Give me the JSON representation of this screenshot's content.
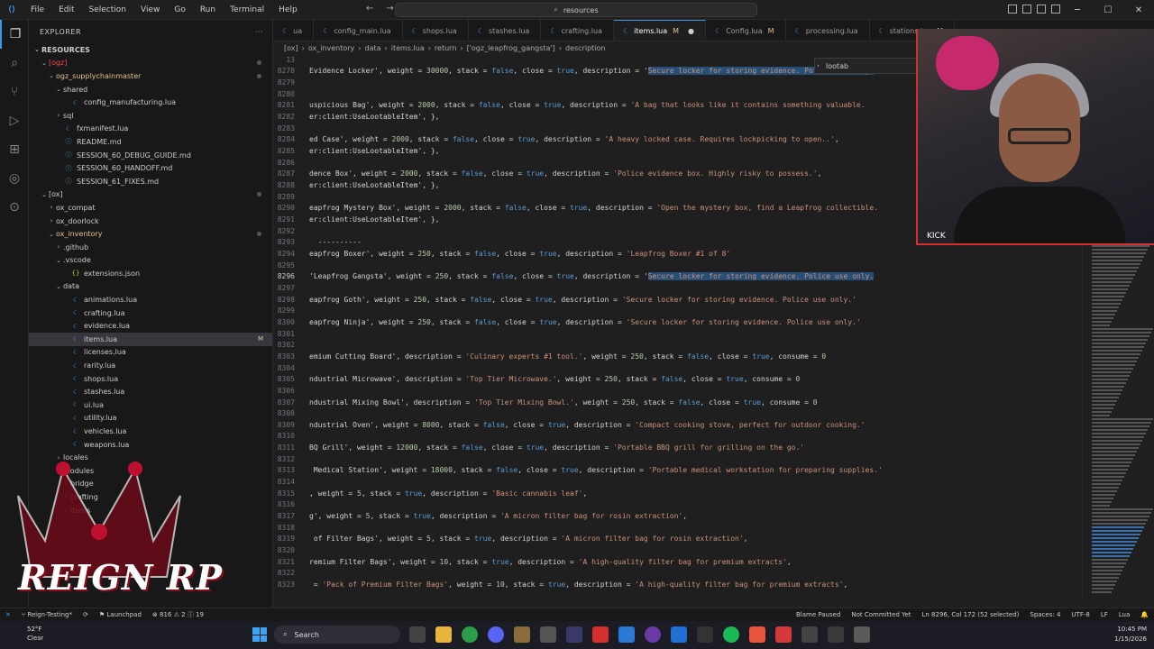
{
  "menu": [
    "File",
    "Edit",
    "Selection",
    "View",
    "Go",
    "Run",
    "Terminal",
    "Help"
  ],
  "search": {
    "text": "resources"
  },
  "sidebar": {
    "title": "EXPLORER",
    "root": "RESOURCES",
    "items": [
      {
        "label": "[ogz]",
        "indent": 1,
        "type": "folder",
        "open": true,
        "color": "red"
      },
      {
        "label": "ogz_supplychainmaster",
        "indent": 2,
        "type": "folder",
        "open": true,
        "color": "gold"
      },
      {
        "label": "shared",
        "indent": 3,
        "type": "folder",
        "open": true
      },
      {
        "label": "config_manufacturing.lua",
        "indent": 4,
        "type": "lua"
      },
      {
        "label": "sql",
        "indent": 3,
        "type": "folder",
        "open": false
      },
      {
        "label": "fxmanifest.lua",
        "indent": 3,
        "type": "lua"
      },
      {
        "label": "README.md",
        "indent": 3,
        "type": "md"
      },
      {
        "label": "SESSION_60_DEBUG_GUIDE.md",
        "indent": 3,
        "type": "md"
      },
      {
        "label": "SESSION_60_HANDOFF.md",
        "indent": 3,
        "type": "md"
      },
      {
        "label": "SESSION_61_FIXES.md",
        "indent": 3,
        "type": "md"
      },
      {
        "label": "[ox]",
        "indent": 1,
        "type": "folder",
        "open": true
      },
      {
        "label": "ox_compat",
        "indent": 2,
        "type": "folder",
        "open": false
      },
      {
        "label": "ox_doorlock",
        "indent": 2,
        "type": "folder",
        "open": false
      },
      {
        "label": "ox_inventory",
        "indent": 2,
        "type": "folder",
        "open": true,
        "color": "gold"
      },
      {
        "label": ".github",
        "indent": 3,
        "type": "folder",
        "open": false
      },
      {
        "label": ".vscode",
        "indent": 3,
        "type": "folder",
        "open": true
      },
      {
        "label": "extensions.json",
        "indent": 4,
        "type": "json"
      },
      {
        "label": "data",
        "indent": 3,
        "type": "folder",
        "open": true
      },
      {
        "label": "animations.lua",
        "indent": 4,
        "type": "lua"
      },
      {
        "label": "crafting.lua",
        "indent": 4,
        "type": "lua"
      },
      {
        "label": "evidence.lua",
        "indent": 4,
        "type": "lua"
      },
      {
        "label": "items.lua",
        "indent": 4,
        "type": "lua",
        "selected": true,
        "badge": "M"
      },
      {
        "label": "licenses.lua",
        "indent": 4,
        "type": "lua"
      },
      {
        "label": "rarity.lua",
        "indent": 4,
        "type": "lua"
      },
      {
        "label": "shops.lua",
        "indent": 4,
        "type": "lua"
      },
      {
        "label": "stashes.lua",
        "indent": 4,
        "type": "lua"
      },
      {
        "label": "ui.lua",
        "indent": 4,
        "type": "lua"
      },
      {
        "label": "utility.lua",
        "indent": 4,
        "type": "lua"
      },
      {
        "label": "vehicles.lua",
        "indent": 4,
        "type": "lua"
      },
      {
        "label": "weapons.lua",
        "indent": 4,
        "type": "lua"
      },
      {
        "label": "locales",
        "indent": 3,
        "type": "folder",
        "open": false
      },
      {
        "label": "modules",
        "indent": 3,
        "type": "folder",
        "open": true
      },
      {
        "label": "bridge",
        "indent": 4,
        "type": "folder",
        "open": false
      },
      {
        "label": "crafting",
        "indent": 4,
        "type": "folder",
        "open": false
      },
      {
        "label": "items",
        "indent": 4,
        "type": "folder",
        "open": false
      }
    ]
  },
  "tabs": [
    {
      "label": "ua",
      "mod": ""
    },
    {
      "label": "config_main.lua",
      "mod": ""
    },
    {
      "label": "shops.lua",
      "mod": ""
    },
    {
      "label": "stashes.lua",
      "mod": ""
    },
    {
      "label": "crafting.lua",
      "mod": ""
    },
    {
      "label": "items.lua",
      "mod": "M",
      "active": true
    },
    {
      "label": "Config.lua",
      "mod": "M"
    },
    {
      "label": "processing.lua",
      "mod": ""
    },
    {
      "label": "stations.lua",
      "mod": "M"
    }
  ],
  "breadcrumb": [
    "[ox]",
    "ox_inventory",
    "data",
    "items.lua",
    "return",
    "['ogz_leapfrog_gangsta']",
    "description"
  ],
  "find_widget": {
    "text": "lootab"
  },
  "code": [
    {
      "ln": "13",
      "segs": []
    },
    {
      "ln": "8278",
      "segs": [
        [
          "t",
          "Evidence Locker', weight = "
        ],
        [
          "n",
          "30000"
        ],
        [
          "t",
          ", stack = "
        ],
        [
          "k",
          "false"
        ],
        [
          "t",
          ", close = "
        ],
        [
          "k",
          "true"
        ],
        [
          "t",
          ", description = '"
        ],
        [
          "h",
          "Secure locker for storing evidence. Police use only."
        ]
      ]
    },
    {
      "ln": "8279",
      "segs": []
    },
    {
      "ln": "8280",
      "segs": []
    },
    {
      "ln": "8281",
      "segs": [
        [
          "t",
          "uspicious Bag', weight = "
        ],
        [
          "n",
          "2000"
        ],
        [
          "t",
          ", stack = "
        ],
        [
          "k",
          "false"
        ],
        [
          "t",
          ", close = "
        ],
        [
          "k",
          "true"
        ],
        [
          "t",
          ", description = "
        ],
        [
          "s",
          "'A bag that looks like it contains something valuable."
        ]
      ]
    },
    {
      "ln": "8282",
      "segs": [
        [
          "t",
          "er:client:UseLootableItem', },"
        ]
      ]
    },
    {
      "ln": "8283",
      "segs": []
    },
    {
      "ln": "8284",
      "segs": [
        [
          "t",
          "ed Case', weight = "
        ],
        [
          "n",
          "2000"
        ],
        [
          "t",
          ", stack = "
        ],
        [
          "k",
          "false"
        ],
        [
          "t",
          ", close = "
        ],
        [
          "k",
          "true"
        ],
        [
          "t",
          ", description = "
        ],
        [
          "s",
          "'A heavy locked case. Requires lockpicking to open..'"
        ],
        [
          "t",
          ","
        ]
      ]
    },
    {
      "ln": "8285",
      "segs": [
        [
          "t",
          "er:client:UseLootableItem', },"
        ]
      ]
    },
    {
      "ln": "8286",
      "segs": []
    },
    {
      "ln": "8287",
      "segs": [
        [
          "t",
          "dence Box', weight = "
        ],
        [
          "n",
          "2000"
        ],
        [
          "t",
          ", stack = "
        ],
        [
          "k",
          "false"
        ],
        [
          "t",
          ", close = "
        ],
        [
          "k",
          "true"
        ],
        [
          "t",
          ", description = "
        ],
        [
          "s",
          "'Police evidence box. Highly risky to possess.'"
        ],
        [
          "t",
          ","
        ]
      ]
    },
    {
      "ln": "8288",
      "segs": [
        [
          "t",
          "er:client:UseLootableItem', },"
        ]
      ]
    },
    {
      "ln": "8289",
      "segs": []
    },
    {
      "ln": "8290",
      "segs": [
        [
          "t",
          "eapfrog Mystery Box', weight = "
        ],
        [
          "n",
          "2000"
        ],
        [
          "t",
          ", stack = "
        ],
        [
          "k",
          "false"
        ],
        [
          "t",
          ", close = "
        ],
        [
          "k",
          "true"
        ],
        [
          "t",
          ", description = "
        ],
        [
          "s",
          "'Open the mystery box, find a Leapfrog collectible."
        ]
      ]
    },
    {
      "ln": "8291",
      "segs": [
        [
          "t",
          "er:client:UseLootableItem', },"
        ]
      ]
    },
    {
      "ln": "8292",
      "segs": []
    },
    {
      "ln": "8293",
      "segs": [
        [
          "t",
          "  ----------"
        ]
      ]
    },
    {
      "ln": "8294",
      "segs": [
        [
          "t",
          "eapfrog Boxer', weight = "
        ],
        [
          "n",
          "250"
        ],
        [
          "t",
          ", stack = "
        ],
        [
          "k",
          "false"
        ],
        [
          "t",
          ", close = "
        ],
        [
          "k",
          "true"
        ],
        [
          "t",
          ", description = "
        ],
        [
          "s",
          "'Leapfrog Boxer #1 of 8'"
        ]
      ]
    },
    {
      "ln": "8295",
      "segs": []
    },
    {
      "ln": "8296",
      "cur": true,
      "segs": [
        [
          "t",
          "'Leapfrog Gangsta', weight = "
        ],
        [
          "n",
          "250"
        ],
        [
          "t",
          ", stack = "
        ],
        [
          "k",
          "false"
        ],
        [
          "t",
          ", close = "
        ],
        [
          "k",
          "true"
        ],
        [
          "t",
          ", description = '"
        ],
        [
          "h",
          "Secure locker for storing evidence. Police use only."
        ]
      ]
    },
    {
      "ln": "8297",
      "segs": []
    },
    {
      "ln": "8298",
      "segs": [
        [
          "t",
          "eapfrog Goth', weight = "
        ],
        [
          "n",
          "250"
        ],
        [
          "t",
          ", stack = "
        ],
        [
          "k",
          "false"
        ],
        [
          "t",
          ", close = "
        ],
        [
          "k",
          "true"
        ],
        [
          "t",
          ", description = "
        ],
        [
          "s",
          "'Secure locker for storing evidence. Police use only.'"
        ]
      ]
    },
    {
      "ln": "8299",
      "segs": []
    },
    {
      "ln": "8300",
      "segs": [
        [
          "t",
          "eapfrog Ninja', weight = "
        ],
        [
          "n",
          "250"
        ],
        [
          "t",
          ", stack = "
        ],
        [
          "k",
          "false"
        ],
        [
          "t",
          ", close = "
        ],
        [
          "k",
          "true"
        ],
        [
          "t",
          ", description = "
        ],
        [
          "s",
          "'Secure locker for storing evidence. Police use only.'"
        ]
      ]
    },
    {
      "ln": "8301",
      "segs": []
    },
    {
      "ln": "8302",
      "segs": []
    },
    {
      "ln": "8303",
      "segs": [
        [
          "t",
          "emium Cutting Board', description = "
        ],
        [
          "s",
          "'Culinary experts #1 tool.'"
        ],
        [
          "t",
          ", weight = "
        ],
        [
          "n",
          "250"
        ],
        [
          "t",
          ", stack = "
        ],
        [
          "k",
          "false"
        ],
        [
          "t",
          ", close = "
        ],
        [
          "k",
          "true"
        ],
        [
          "t",
          ", consume = "
        ],
        [
          "n",
          "0"
        ]
      ]
    },
    {
      "ln": "8304",
      "segs": []
    },
    {
      "ln": "8305",
      "segs": [
        [
          "t",
          "ndustrial Microwave', description = "
        ],
        [
          "s",
          "'Top Tier Microwave.'"
        ],
        [
          "t",
          ", weight = "
        ],
        [
          "n",
          "250"
        ],
        [
          "t",
          ", stack = "
        ],
        [
          "k",
          "false"
        ],
        [
          "t",
          ", close = "
        ],
        [
          "k",
          "true"
        ],
        [
          "t",
          ", consume = "
        ],
        [
          "n",
          "0"
        ]
      ]
    },
    {
      "ln": "8306",
      "segs": []
    },
    {
      "ln": "8307",
      "segs": [
        [
          "t",
          "ndustrial Mixing Bowl', description = "
        ],
        [
          "s",
          "'Top Tier Mixing Bowl.'"
        ],
        [
          "t",
          ", weight = "
        ],
        [
          "n",
          "250"
        ],
        [
          "t",
          ", stack = "
        ],
        [
          "k",
          "false"
        ],
        [
          "t",
          ", close = "
        ],
        [
          "k",
          "true"
        ],
        [
          "t",
          ", consume = "
        ],
        [
          "n",
          "0"
        ]
      ]
    },
    {
      "ln": "8308",
      "segs": []
    },
    {
      "ln": "8309",
      "segs": [
        [
          "t",
          "ndustrial Oven', weight = "
        ],
        [
          "n",
          "8000"
        ],
        [
          "t",
          ", stack = "
        ],
        [
          "k",
          "false"
        ],
        [
          "t",
          ", close = "
        ],
        [
          "k",
          "true"
        ],
        [
          "t",
          ", description = "
        ],
        [
          "s",
          "'Compact cooking stove, perfect for outdoor cooking.'"
        ]
      ]
    },
    {
      "ln": "8310",
      "segs": []
    },
    {
      "ln": "8311",
      "segs": [
        [
          "t",
          "BQ Grill', weight = "
        ],
        [
          "n",
          "12000"
        ],
        [
          "t",
          ", stack = "
        ],
        [
          "k",
          "false"
        ],
        [
          "t",
          ", close = "
        ],
        [
          "k",
          "true"
        ],
        [
          "t",
          ", description = "
        ],
        [
          "s",
          "'Portable BBQ grill for grilling on the go.'"
        ]
      ]
    },
    {
      "ln": "8312",
      "segs": []
    },
    {
      "ln": "8313",
      "segs": [
        [
          "t",
          " Medical Station', weight = "
        ],
        [
          "n",
          "18000"
        ],
        [
          "t",
          ", stack = "
        ],
        [
          "k",
          "false"
        ],
        [
          "t",
          ", close = "
        ],
        [
          "k",
          "true"
        ],
        [
          "t",
          ", description = "
        ],
        [
          "s",
          "'Portable medical workstation for preparing supplies.'"
        ]
      ]
    },
    {
      "ln": "8314",
      "segs": []
    },
    {
      "ln": "8315",
      "segs": [
        [
          "t",
          ", weight = "
        ],
        [
          "n",
          "5"
        ],
        [
          "t",
          ", stack = "
        ],
        [
          "k",
          "true"
        ],
        [
          "t",
          ", description = "
        ],
        [
          "s",
          "'Basic cannabis leaf'"
        ],
        [
          "t",
          ","
        ]
      ]
    },
    {
      "ln": "8316",
      "segs": []
    },
    {
      "ln": "8317",
      "segs": [
        [
          "t",
          "g', weight = "
        ],
        [
          "n",
          "5"
        ],
        [
          "t",
          ", stack = "
        ],
        [
          "k",
          "true"
        ],
        [
          "t",
          ", description = "
        ],
        [
          "s",
          "'A micron filter bag for rosin extraction'"
        ],
        [
          "t",
          ","
        ]
      ]
    },
    {
      "ln": "8318",
      "segs": []
    },
    {
      "ln": "8319",
      "segs": [
        [
          "t",
          " of Filter Bags', weight = "
        ],
        [
          "n",
          "5"
        ],
        [
          "t",
          ", stack = "
        ],
        [
          "k",
          "true"
        ],
        [
          "t",
          ", description = "
        ],
        [
          "s",
          "'A micron filter bag for rosin extraction'"
        ],
        [
          "t",
          ","
        ]
      ]
    },
    {
      "ln": "8320",
      "segs": []
    },
    {
      "ln": "8321",
      "segs": [
        [
          "t",
          "remium Filter Bags', weight = "
        ],
        [
          "n",
          "10"
        ],
        [
          "t",
          ", stack = "
        ],
        [
          "k",
          "true"
        ],
        [
          "t",
          ", description = "
        ],
        [
          "s",
          "'A high-quality filter bag for premium extracts'"
        ],
        [
          "t",
          ","
        ]
      ]
    },
    {
      "ln": "8322",
      "segs": []
    },
    {
      "ln": "8323",
      "segs": [
        [
          "t",
          " = "
        ],
        [
          "s",
          "'Pack of Premium Filter Bags'"
        ],
        [
          "t",
          ", weight = "
        ],
        [
          "n",
          "10"
        ],
        [
          "t",
          ", stack = "
        ],
        [
          "k",
          "true"
        ],
        [
          "t",
          ", description = "
        ],
        [
          "s",
          "'A high-quality filter bag for premium extracts'"
        ],
        [
          "t",
          ","
        ]
      ]
    }
  ],
  "statusbar": {
    "branch": "Reign-Testing*",
    "problems": "816",
    "warnings": "2",
    "info": "19",
    "launchpad": "Launchpad",
    "blame": "Blame Paused",
    "commit": "Not Committed Yet",
    "cursor": "Ln 8296, Col 172 (52 selected)",
    "spaces": "Spaces: 4",
    "encoding": "UTF-8",
    "eol": "LF",
    "lang": "Lua"
  },
  "webcam": {
    "label": "KICK"
  },
  "watermark": "REIGN RP",
  "taskbar": {
    "temp": "52°F",
    "weather": "Clear",
    "search": "Search",
    "time": "10:45 PM",
    "date": "1/15/2026"
  },
  "colors": {
    "accent": "#3b9ae8",
    "modified": "#e2c08d",
    "selection": "#264f78",
    "brand_red": "#d4312c"
  }
}
